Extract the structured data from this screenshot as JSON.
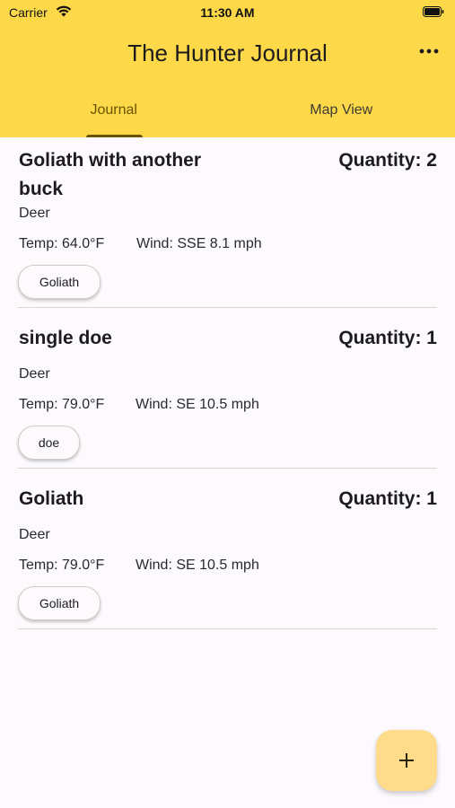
{
  "status_bar": {
    "carrier": "Carrier",
    "time": "11:30 AM",
    "icons": [
      "wifi-icon",
      "battery-icon"
    ]
  },
  "app_bar": {
    "title": "The Hunter Journal",
    "menu_icon": "more-horizontal-icon"
  },
  "tabs": [
    {
      "label": "Journal",
      "selected": true
    },
    {
      "label": "Map View",
      "selected": false
    }
  ],
  "entries": [
    {
      "title_line1": "Goliath with another",
      "title_line2": "buck",
      "quantity": "Quantity: 2",
      "species": "Deer",
      "temp": "Temp: 64.0°F",
      "wind": "Wind: SSE 8.1 mph",
      "tag": "Goliath"
    },
    {
      "title_line1": "single doe",
      "title_line2": "",
      "quantity": "Quantity: 1",
      "species": "Deer",
      "temp": "Temp: 79.0°F",
      "wind": "Wind: SE 10.5 mph",
      "tag": "doe"
    },
    {
      "title_line1": "Goliath",
      "title_line2": "",
      "quantity": "Quantity: 1",
      "species": "Deer",
      "temp": "Temp: 79.0°F",
      "wind": "Wind: SE 10.5 mph",
      "tag": "Goliath"
    }
  ],
  "fab": {
    "icon": "plus-icon"
  },
  "colors": {
    "header_bg": "#FDD849",
    "tab_indicator": "#6b5300",
    "fab_bg": "#FFDB8C",
    "page_bg": "#FCFAFD"
  }
}
